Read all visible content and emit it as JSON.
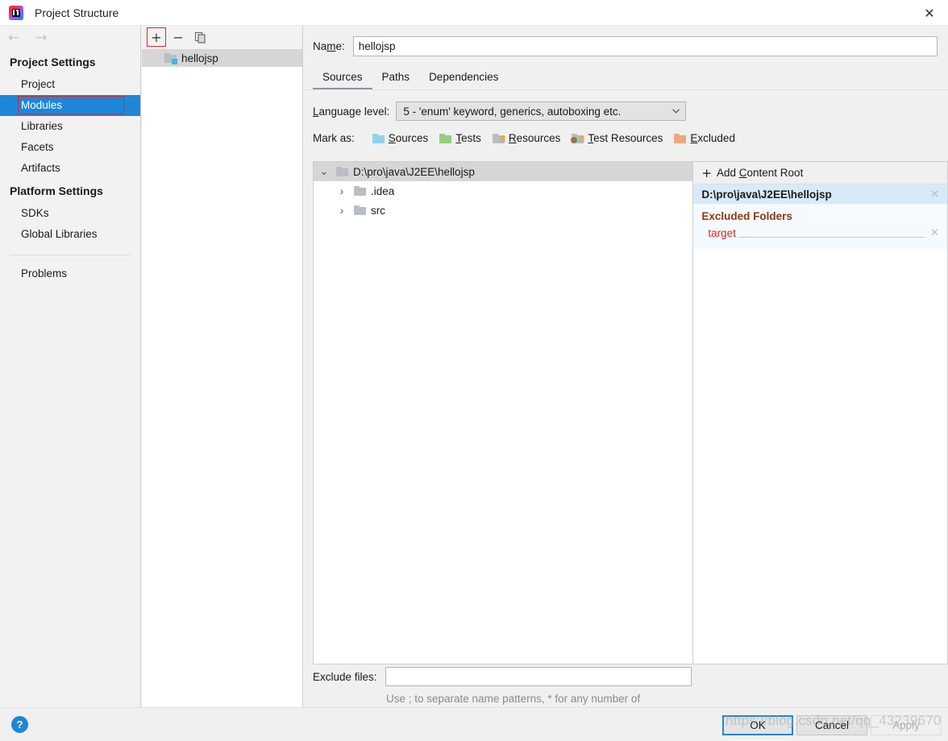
{
  "window": {
    "title": "Project Structure",
    "logo_icon": "intellij-idea-logo",
    "close_icon": "✕"
  },
  "sidebar": {
    "back_icon": "←",
    "forward_icon": "→",
    "groups": [
      {
        "label": "Project Settings",
        "items": [
          {
            "label": "Project",
            "selected": false
          },
          {
            "label": "Modules",
            "selected": true
          },
          {
            "label": "Libraries",
            "selected": false
          },
          {
            "label": "Facets",
            "selected": false
          },
          {
            "label": "Artifacts",
            "selected": false
          }
        ]
      },
      {
        "label": "Platform Settings",
        "items": [
          {
            "label": "SDKs",
            "selected": false
          },
          {
            "label": "Global Libraries",
            "selected": false
          }
        ]
      }
    ],
    "problems_label": "Problems"
  },
  "module_list": {
    "toolbar": {
      "add_label": "+",
      "remove_label": "−",
      "copy_label": "copy-icon"
    },
    "items": [
      {
        "label": "hellojsp",
        "icon": "module-folder-icon",
        "selected": true
      }
    ]
  },
  "main": {
    "name_label_pre": "Na",
    "name_label_mnemonic": "m",
    "name_label_post": "e:",
    "name_value": "hellojsp",
    "tabs": [
      {
        "label": "Sources",
        "active": true
      },
      {
        "label": "Paths",
        "active": false
      },
      {
        "label": "Dependencies",
        "active": false
      }
    ],
    "language_level_label_mnemonic": "L",
    "language_level_label_rest": "anguage level:",
    "language_level_value": "5 - 'enum' keyword, generics, autoboxing etc.",
    "mark_as_label": "Mark as:",
    "mark_as_options": [
      {
        "mnemonic": "S",
        "rest": "ources",
        "icon": "sources-folder-icon",
        "color": "#8fd3ee"
      },
      {
        "mnemonic": "T",
        "rest": "ests",
        "icon": "tests-folder-icon",
        "color": "#96cc7f"
      },
      {
        "mnemonic": "R",
        "rest": "esources",
        "icon": "resources-folder-icon",
        "color": "#b9bec4"
      },
      {
        "mnemonic": "T",
        "rest": "est Resources",
        "icon": "test-resources-folder-icon",
        "color": "#b9bec4"
      },
      {
        "mnemonic": "E",
        "rest": "xcluded",
        "icon": "excluded-folder-icon",
        "color": "#f0a882"
      }
    ],
    "tree": [
      {
        "label": "D:\\pro\\java\\J2EE\\hellojsp",
        "depth": 0,
        "expanded": true,
        "twisty": "⌄",
        "selected": true
      },
      {
        "label": ".idea",
        "depth": 1,
        "expanded": false,
        "twisty": "›",
        "selected": false
      },
      {
        "label": "src",
        "depth": 1,
        "expanded": false,
        "twisty": "›",
        "selected": false
      }
    ],
    "info_panel": {
      "add_content_root_pre": "Add ",
      "add_content_root_mnemonic": "C",
      "add_content_root_post": "ontent Root",
      "plus_icon": "+",
      "content_root_path": "D:\\pro\\java\\J2EE\\hellojsp",
      "remove_icon": "✕",
      "excluded_folders_title": "Excluded Folders",
      "excluded_folders": [
        {
          "name": "target",
          "remove_icon": "✕"
        }
      ]
    },
    "exclude_files_label": "Exclude files:",
    "exclude_files_value": "",
    "exclude_files_placeholder": "",
    "exclude_files_hint": "Use ; to separate name patterns, * for any number of symbols, ? for one."
  },
  "footer": {
    "help_label": "?",
    "buttons": [
      {
        "label": "OK",
        "style": "default"
      },
      {
        "label": "Cancel",
        "style": "normal"
      },
      {
        "label": "Apply",
        "style": "disabled"
      }
    ]
  },
  "watermark": "https://blog.csdn.net/qq_43239670"
}
